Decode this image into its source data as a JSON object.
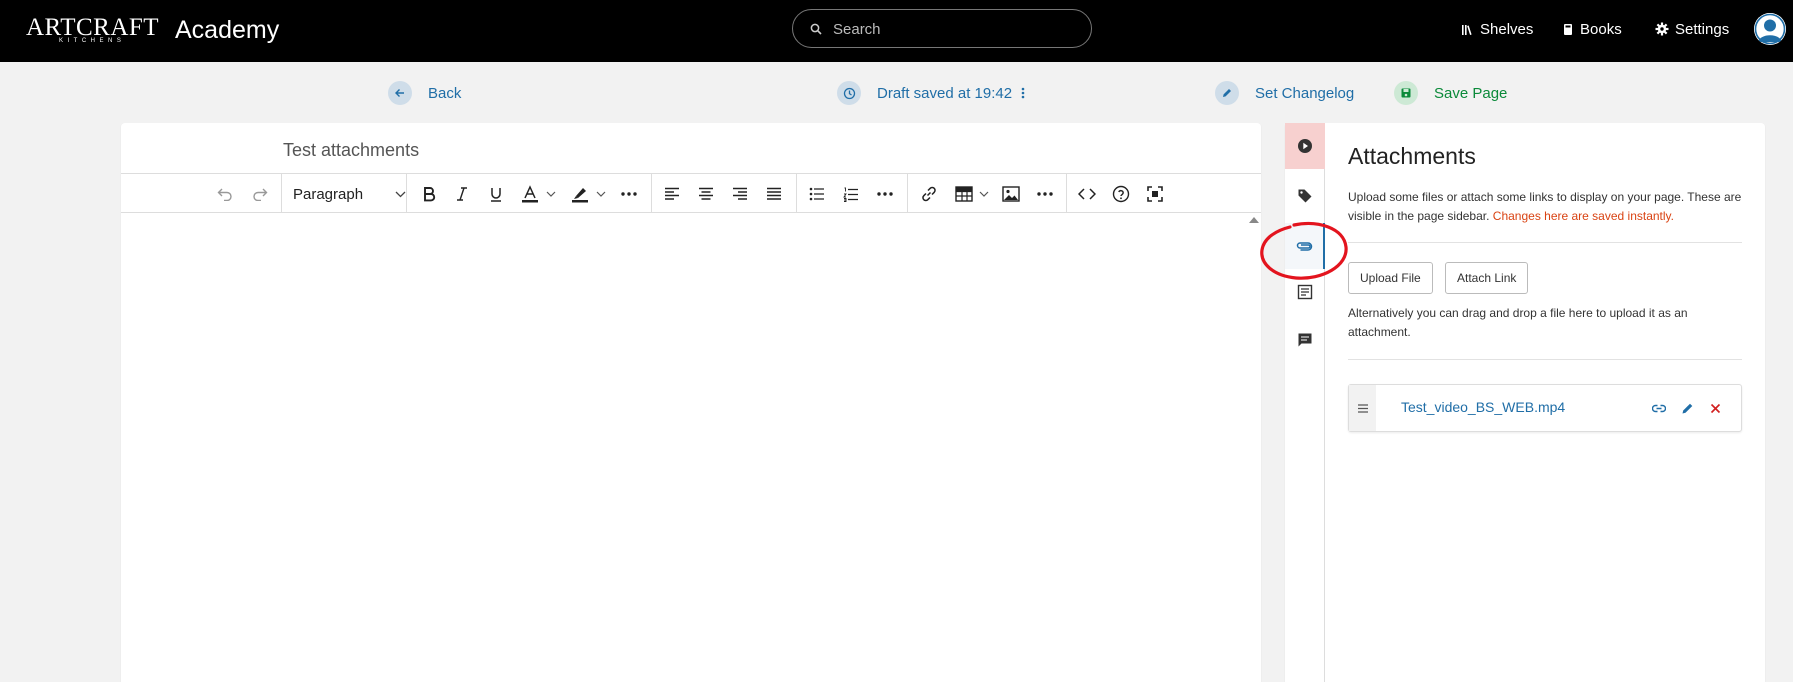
{
  "header": {
    "logo_text": "ARTCRAFT",
    "logo_subtext": "KITCHENS",
    "app_name": "Academy",
    "search_placeholder": "Search",
    "nav": [
      {
        "label": "Shelves",
        "icon": "shelves-icon"
      },
      {
        "label": "Books",
        "icon": "books-icon"
      },
      {
        "label": "Settings",
        "icon": "gear-icon"
      }
    ]
  },
  "actions": {
    "back_label": "Back",
    "draft_status": "Draft saved at 19:42",
    "set_changelog_label": "Set Changelog",
    "save_page_label": "Save Page"
  },
  "editor": {
    "title": "Test attachments",
    "block_format": "Paragraph"
  },
  "sidebar": {
    "tabs": [
      {
        "icon": "play-icon",
        "active": false
      },
      {
        "icon": "tag-icon",
        "active": false
      },
      {
        "icon": "paperclip-icon",
        "active": true
      },
      {
        "icon": "template-icon",
        "active": false
      },
      {
        "icon": "comment-icon",
        "active": false
      }
    ],
    "attachments": {
      "title": "Attachments",
      "description": "Upload some files or attach some links to display on your page. These are visible in the page sidebar.",
      "instant_note": "Changes here are saved instantly.",
      "upload_file_label": "Upload File",
      "attach_link_label": "Attach Link",
      "drag_drop_note": "Alternatively you can drag and drop a file here to upload it as an attachment.",
      "items": [
        {
          "name": "Test_video_BS_WEB.mp4"
        }
      ]
    }
  },
  "colors": {
    "link": "#206ea7",
    "save": "#0b8a3a",
    "danger": "#d94313",
    "delete": "#d21f1f",
    "annotation": "#e3141e",
    "header_bg": "#000000"
  }
}
